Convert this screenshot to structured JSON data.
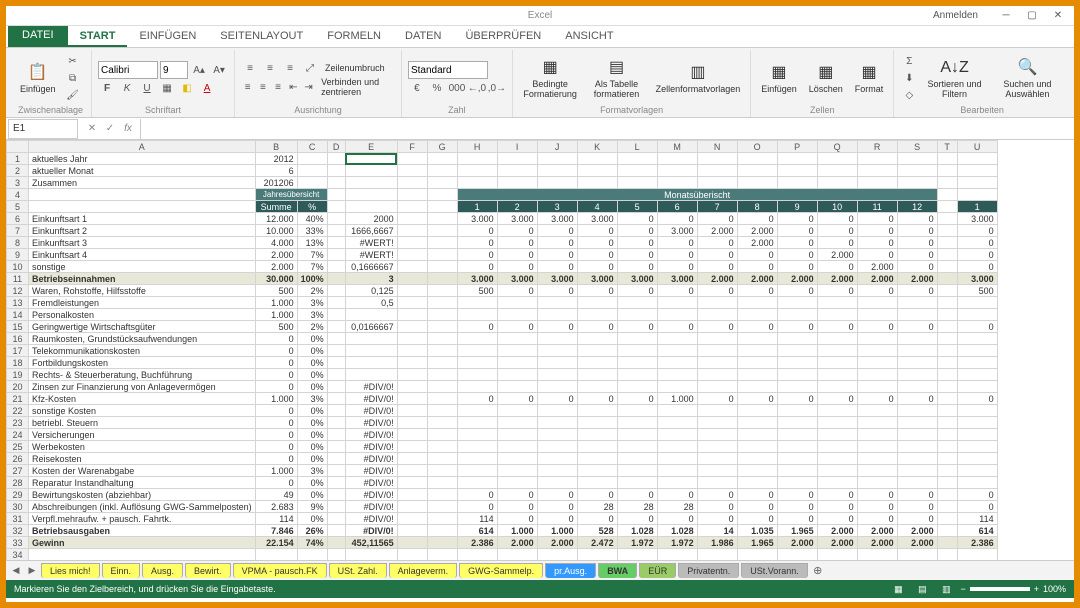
{
  "title": "Excel",
  "login": "Anmelden",
  "tabs": {
    "file": "DATEI",
    "start": "START",
    "insert": "EINFÜGEN",
    "layout": "SEITENLAYOUT",
    "formulas": "FORMELN",
    "data": "DATEN",
    "review": "ÜBERPRÜFEN",
    "view": "ANSICHT"
  },
  "ribbon": {
    "clipboard": {
      "paste": "Einfügen",
      "label": "Zwischenablage"
    },
    "font": {
      "family": "Calibri",
      "size": "9",
      "label": "Schriftart"
    },
    "align": {
      "wrap": "Zeilenumbruch",
      "merge": "Verbinden und zentrieren",
      "label": "Ausrichtung"
    },
    "number": {
      "fmt": "Standard",
      "label": "Zahl"
    },
    "styles": {
      "cond": "Bedingte Formatierung",
      "table": "Als Tabelle formatieren",
      "cell": "Zellenformatvorlagen",
      "label": "Formatvorlagen"
    },
    "cells": {
      "ins": "Einfügen",
      "del": "Löschen",
      "fmt": "Format",
      "label": "Zellen"
    },
    "edit": {
      "sort": "Sortieren und Filtern",
      "find": "Suchen und Auswählen",
      "label": "Bearbeiten"
    }
  },
  "name_box": "E1",
  "formula": "",
  "cols": [
    "A",
    "B",
    "C",
    "D",
    "E",
    "F",
    "G",
    "H",
    "I",
    "J",
    "K",
    "L",
    "M",
    "N",
    "O",
    "P",
    "Q",
    "R",
    "S",
    "T",
    "U"
  ],
  "hdr_year": {
    "sum": "Summe",
    "pct": "%",
    "title": "Jahresübersicht"
  },
  "hdr_month_title": "Monatsüberischt",
  "months": [
    "1",
    "2",
    "3",
    "4",
    "5",
    "6",
    "7",
    "8",
    "9",
    "10",
    "11",
    "12"
  ],
  "extra_month": "1",
  "rows": [
    {
      "n": 1,
      "a": "aktuelles Jahr",
      "b": "2012"
    },
    {
      "n": 2,
      "a": "aktueller Monat",
      "b": "6"
    },
    {
      "n": 3,
      "a": "Zusammen",
      "b": "201206"
    },
    {
      "n": 4,
      "a": ""
    },
    {
      "n": 5,
      "a": ""
    },
    {
      "n": 6,
      "a": "Einkunftsart 1",
      "b": "12.000",
      "c": "40%",
      "e": "2000",
      "m": [
        "3.000",
        "3.000",
        "3.000",
        "3.000",
        "0",
        "0",
        "0",
        "0",
        "0",
        "0",
        "0",
        "0"
      ],
      "x": "3.000"
    },
    {
      "n": 7,
      "a": "Einkunftsart 2",
      "b": "10.000",
      "c": "33%",
      "e": "1666,6667",
      "m": [
        "0",
        "0",
        "0",
        "0",
        "0",
        "3.000",
        "2.000",
        "2.000",
        "0",
        "0",
        "0",
        "0"
      ],
      "x": "0"
    },
    {
      "n": 8,
      "a": "Einkunftsart 3",
      "b": "4.000",
      "c": "13%",
      "e": "#WERT!",
      "m": [
        "0",
        "0",
        "0",
        "0",
        "0",
        "0",
        "0",
        "2.000",
        "0",
        "0",
        "0",
        "0"
      ],
      "x": "0"
    },
    {
      "n": 9,
      "a": "Einkunftsart 4",
      "b": "2.000",
      "c": "7%",
      "e": "#WERT!",
      "m": [
        "0",
        "0",
        "0",
        "0",
        "0",
        "0",
        "0",
        "0",
        "0",
        "2.000",
        "0",
        "0"
      ],
      "x": "0"
    },
    {
      "n": 10,
      "a": "sonstige",
      "b": "2.000",
      "c": "7%",
      "e": "0,1666667",
      "m": [
        "0",
        "0",
        "0",
        "0",
        "0",
        "0",
        "0",
        "0",
        "0",
        "0",
        "2.000",
        "0"
      ],
      "x": "0"
    },
    {
      "n": 11,
      "a": "Betriebseinnahmen",
      "b": "30.000",
      "c": "100%",
      "e": "3",
      "m": [
        "3.000",
        "3.000",
        "3.000",
        "3.000",
        "3.000",
        "3.000",
        "2.000",
        "2.000",
        "2.000",
        "2.000",
        "2.000",
        "2.000"
      ],
      "x": "3.000",
      "sty": "sum"
    },
    {
      "n": 12,
      "a": "Waren, Rohstoffe, Hilfsstoffe",
      "b": "500",
      "c": "2%",
      "e": "0,125",
      "m": [
        "500",
        "0",
        "0",
        "0",
        "0",
        "0",
        "0",
        "0",
        "0",
        "0",
        "0",
        "0"
      ],
      "x": "500"
    },
    {
      "n": 13,
      "a": "Fremdleistungen",
      "b": "1.000",
      "c": "3%",
      "e": "0,5",
      "m": [
        "",
        "",
        "",
        "",
        "",
        "",
        "",
        "",
        "",
        "",
        "",
        ""
      ],
      "x": ""
    },
    {
      "n": 14,
      "a": "Personalkosten",
      "b": "1.000",
      "c": "3%",
      "e": "",
      "m": [
        "",
        "",
        "",
        "",
        "",
        "",
        "",
        "",
        "",
        "",
        "",
        ""
      ],
      "x": ""
    },
    {
      "n": 15,
      "a": "Geringwertige Wirtschaftsgüter",
      "b": "500",
      "c": "2%",
      "e": "0,0166667",
      "m": [
        "0",
        "0",
        "0",
        "0",
        "0",
        "0",
        "0",
        "0",
        "0",
        "0",
        "0",
        "0"
      ],
      "x": "0"
    },
    {
      "n": 16,
      "a": "Raumkosten, Grundstücksaufwendungen",
      "b": "0",
      "c": "0%",
      "e": "",
      "m": [
        "",
        "",
        "",
        "",
        "",
        "",
        "",
        "",
        "",
        "",
        "",
        ""
      ],
      "x": ""
    },
    {
      "n": 17,
      "a": "Telekommunikationskosten",
      "b": "0",
      "c": "0%",
      "e": "",
      "m": [
        "",
        "",
        "",
        "",
        "",
        "",
        "",
        "",
        "",
        "",
        "",
        ""
      ],
      "x": ""
    },
    {
      "n": 18,
      "a": "Fortbildungskosten",
      "b": "0",
      "c": "0%",
      "e": "",
      "m": [
        "",
        "",
        "",
        "",
        "",
        "",
        "",
        "",
        "",
        "",
        "",
        ""
      ],
      "x": ""
    },
    {
      "n": 19,
      "a": "Rechts- & Steuerberatung, Buchführung",
      "b": "0",
      "c": "0%",
      "e": "",
      "m": [
        "",
        "",
        "",
        "",
        "",
        "",
        "",
        "",
        "",
        "",
        "",
        ""
      ],
      "x": ""
    },
    {
      "n": 20,
      "a": "Zinsen zur Finanzierung von Anlagevermögen",
      "b": "0",
      "c": "0%",
      "e": "#DIV/0!",
      "m": [
        "",
        "",
        "",
        "",
        "",
        "",
        "",
        "",
        "",
        "",
        "",
        ""
      ],
      "x": ""
    },
    {
      "n": 21,
      "a": "Kfz-Kosten",
      "b": "1.000",
      "c": "3%",
      "e": "#DIV/0!",
      "m": [
        "0",
        "0",
        "0",
        "0",
        "0",
        "1.000",
        "0",
        "0",
        "0",
        "0",
        "0",
        "0"
      ],
      "x": "0"
    },
    {
      "n": 22,
      "a": "sonstige Kosten",
      "b": "0",
      "c": "0%",
      "e": "#DIV/0!",
      "m": [
        "",
        "",
        "",
        "",
        "",
        "",
        "",
        "",
        "",
        "",
        "",
        ""
      ],
      "x": ""
    },
    {
      "n": 23,
      "a": "betriebl. Steuern",
      "b": "0",
      "c": "0%",
      "e": "#DIV/0!",
      "m": [
        "",
        "",
        "",
        "",
        "",
        "",
        "",
        "",
        "",
        "",
        "",
        ""
      ],
      "x": ""
    },
    {
      "n": 24,
      "a": "Versicherungen",
      "b": "0",
      "c": "0%",
      "e": "#DIV/0!",
      "m": [
        "",
        "",
        "",
        "",
        "",
        "",
        "",
        "",
        "",
        "",
        "",
        ""
      ],
      "x": ""
    },
    {
      "n": 25,
      "a": "Werbekosten",
      "b": "0",
      "c": "0%",
      "e": "#DIV/0!",
      "m": [
        "",
        "",
        "",
        "",
        "",
        "",
        "",
        "",
        "",
        "",
        "",
        ""
      ],
      "x": ""
    },
    {
      "n": 26,
      "a": "Reisekosten",
      "b": "0",
      "c": "0%",
      "e": "#DIV/0!",
      "m": [
        "",
        "",
        "",
        "",
        "",
        "",
        "",
        "",
        "",
        "",
        "",
        ""
      ],
      "x": ""
    },
    {
      "n": 27,
      "a": "Kosten der Warenabgabe",
      "b": "1.000",
      "c": "3%",
      "e": "#DIV/0!",
      "m": [
        "",
        "",
        "",
        "",
        "",
        "",
        "",
        "",
        "",
        "",
        "",
        ""
      ],
      "x": ""
    },
    {
      "n": 28,
      "a": "Reparatur Instandhaltung",
      "b": "0",
      "c": "0%",
      "e": "#DIV/0!",
      "m": [
        "",
        "",
        "",
        "",
        "",
        "",
        "",
        "",
        "",
        "",
        "",
        ""
      ],
      "x": ""
    },
    {
      "n": 29,
      "a": "Bewirtungskosten (abziehbar)",
      "b": "49",
      "c": "0%",
      "e": "#DIV/0!",
      "m": [
        "0",
        "0",
        "0",
        "0",
        "0",
        "0",
        "0",
        "0",
        "0",
        "0",
        "0",
        "0"
      ],
      "x": "0"
    },
    {
      "n": 30,
      "a": "Abschreibungen (inkl. Auflösung GWG-Sammelposten)",
      "b": "2.683",
      "c": "9%",
      "e": "#DIV/0!",
      "m": [
        "0",
        "0",
        "0",
        "28",
        "28",
        "28",
        "0",
        "0",
        "0",
        "0",
        "0",
        "0"
      ],
      "x": "0"
    },
    {
      "n": 31,
      "a": "Verpfl.mehraufw. + pausch. Fahrtk.",
      "b": "114",
      "c": "0%",
      "e": "#DIV/0!",
      "m": [
        "114",
        "0",
        "0",
        "0",
        "0",
        "0",
        "0",
        "0",
        "0",
        "0",
        "0",
        "0"
      ],
      "x": "114"
    },
    {
      "n": 32,
      "a": "Betriebsausgaben",
      "b": "7.846",
      "c": "26%",
      "e": "#DIV/0!",
      "m": [
        "614",
        "1.000",
        "1.000",
        "528",
        "1.028",
        "1.028",
        "14",
        "1.035",
        "1.965",
        "2.000",
        "2.000",
        "2.000"
      ],
      "x": "614",
      "sty": "strong"
    },
    {
      "n": 33,
      "a": "Gewinn",
      "b": "22.154",
      "c": "74%",
      "e": "452,11565",
      "m": [
        "2.386",
        "2.000",
        "2.000",
        "2.472",
        "1.972",
        "1.972",
        "1.986",
        "1.965",
        "2.000",
        "2.000",
        "2.000",
        "2.000"
      ],
      "x": "2.386",
      "sty": "sum"
    },
    {
      "n": 34,
      "a": ""
    },
    {
      "n": 35,
      "a": ""
    },
    {
      "n": 36,
      "a": ""
    },
    {
      "n": 37,
      "a": ""
    },
    {
      "n": 38,
      "a": ""
    }
  ],
  "sheets": [
    {
      "name": "Lies mich!",
      "color": "yellow"
    },
    {
      "name": "Einn.",
      "color": "yellow"
    },
    {
      "name": "Ausg.",
      "color": "yellow"
    },
    {
      "name": "Bewirt.",
      "color": "yellow"
    },
    {
      "name": "VPMA - pausch.FK",
      "color": "yellow"
    },
    {
      "name": "USt. Zahl.",
      "color": "yellow"
    },
    {
      "name": "Anlageverm.",
      "color": "yellow"
    },
    {
      "name": "GWG-Sammelp.",
      "color": "yellow"
    },
    {
      "name": "pr.Ausg.",
      "color": "blue"
    },
    {
      "name": "BWA",
      "color": "green",
      "active": true
    },
    {
      "name": "EÜR",
      "color": "ltgreen"
    },
    {
      "name": "Privatentn.",
      "color": "gray"
    },
    {
      "name": "USt.Vorann.",
      "color": "gray"
    }
  ],
  "status": {
    "msg": "Markieren Sie den Zielbereich, und drücken Sie die Eingabetaste.",
    "zoom": "100%"
  }
}
